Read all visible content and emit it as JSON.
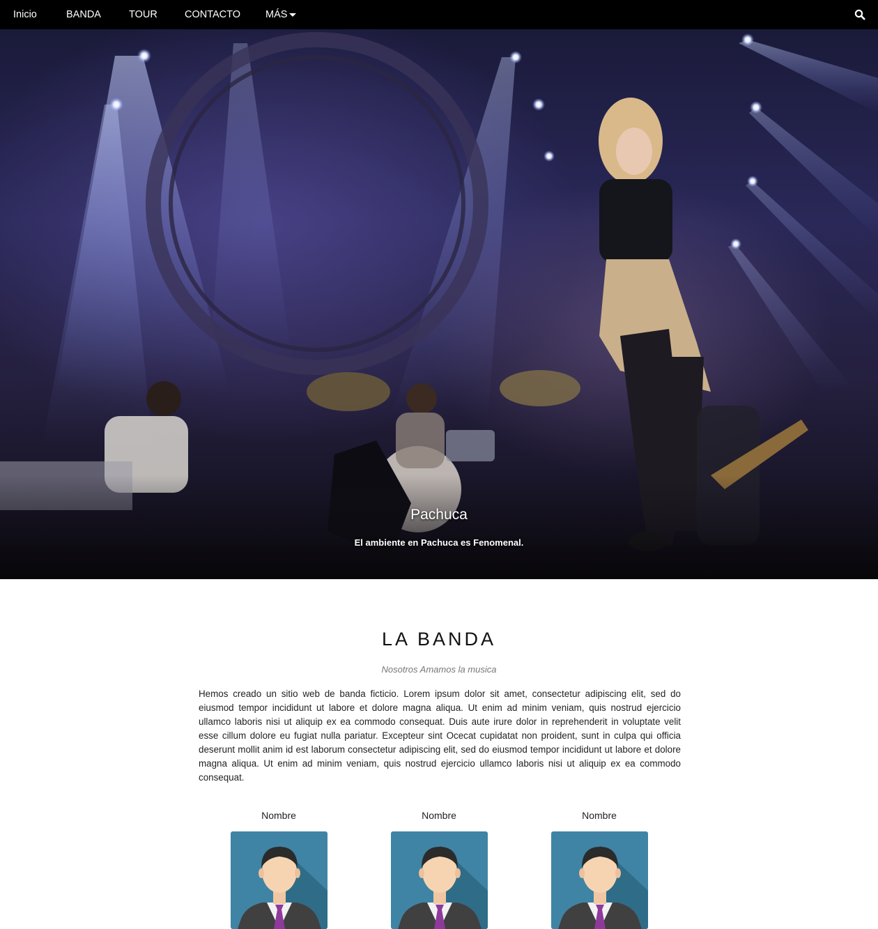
{
  "navbar": {
    "items": [
      {
        "label": "Inicio"
      },
      {
        "label": "BANDA"
      },
      {
        "label": "TOUR"
      },
      {
        "label": "CONTACTO"
      },
      {
        "label": "MÁS"
      }
    ]
  },
  "hero": {
    "caption_title": "Pachuca",
    "caption_text": "El ambiente en Pachuca es Fenomenal."
  },
  "band": {
    "title": "LA BANDA",
    "tagline": "Nosotros Amamos la musica",
    "description": "Hemos creado un sitio web de banda ficticio. Lorem ipsum dolor sit amet, consectetur adipiscing elit, sed do eiusmod tempor incididunt ut labore et dolore magna aliqua. Ut enim ad minim veniam, quis nostrud ejercicio ullamco laboris nisi ut aliquip ex ea commodo consequat. Duis aute irure dolor in reprehenderit in voluptate velit esse cillum dolore eu fugiat nulla pariatur. Excepteur sint Ocecat cupidatat non proident, sunt in culpa qui officia deserunt mollit anim id est laborum consectetur adipiscing elit, sed do eiusmod tempor incididunt ut labore et dolore magna aliqua. Ut enim ad minim veniam, quis nostrud ejercicio ullamco laboris nisi ut aliquip ex ea commodo consequat.",
    "members": [
      {
        "name": "Nombre"
      },
      {
        "name": "Nombre"
      },
      {
        "name": "Nombre"
      }
    ]
  },
  "colors": {
    "navbar_bg": "#000000",
    "avatar_bg": "#3f84a4"
  }
}
